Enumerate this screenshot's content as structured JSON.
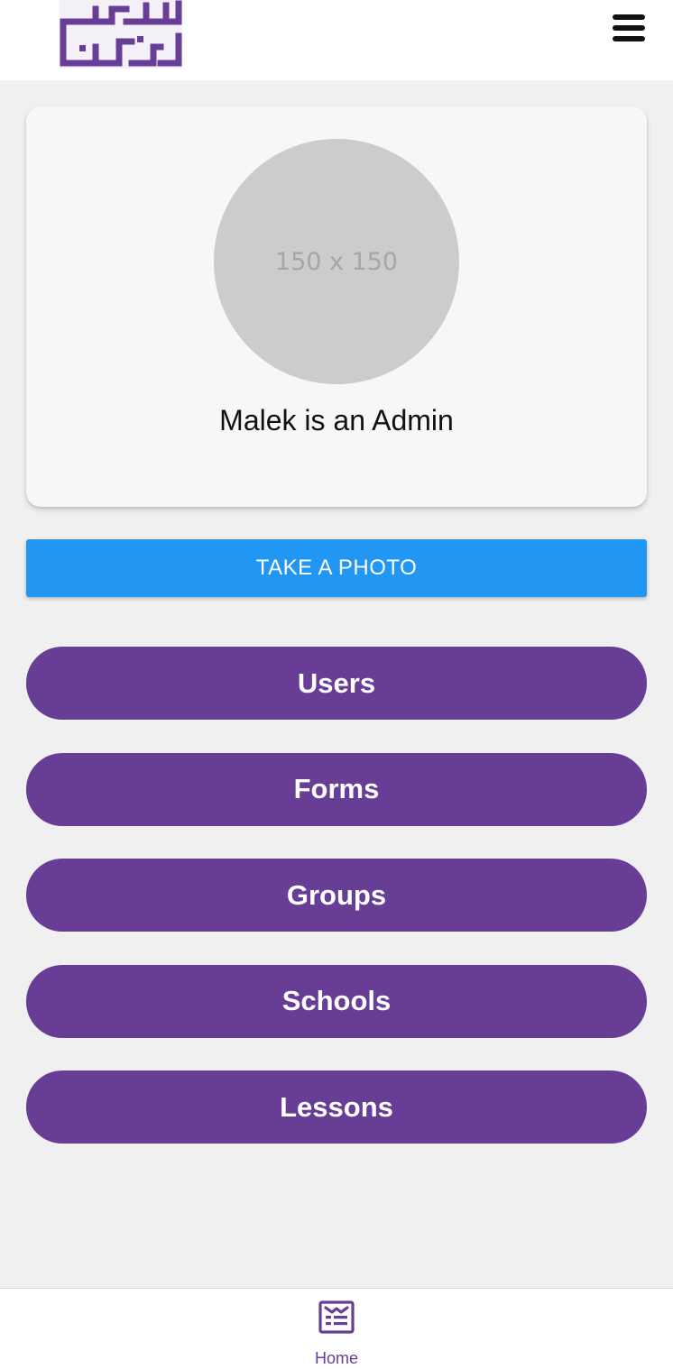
{
  "header": {
    "logo_alt": "شطرنج القدس",
    "menu_icon": "hamburger-menu-icon"
  },
  "profile": {
    "avatar_placeholder": "150 x 150",
    "name_text": "Malek is an Admin"
  },
  "actions": {
    "take_photo_label": "TAKE A PHOTO"
  },
  "nav": {
    "items": [
      {
        "label": "Users"
      },
      {
        "label": "Forms"
      },
      {
        "label": "Groups"
      },
      {
        "label": "Schools"
      },
      {
        "label": "Lessons"
      }
    ]
  },
  "bottom_nav": {
    "home_label": "Home",
    "home_icon": "newspaper-icon"
  },
  "colors": {
    "brand_purple": "#673d96",
    "primary_blue": "#2196f3",
    "background": "#f0f0f0"
  }
}
